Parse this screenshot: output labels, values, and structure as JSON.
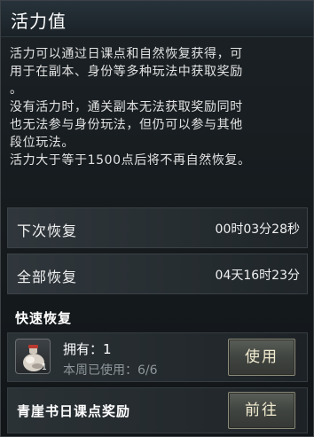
{
  "header": {
    "title": "活力值"
  },
  "description": {
    "lines": [
      "活力可以通过日课点和自然恢复获得，可",
      "用于在副本、身份等多种玩法中获取奖励",
      "。",
      "没有活力时，通关副本无法获取奖励同时",
      "也无法参与身份玩法，但仍可以参与其他",
      "段位玩法。",
      "活力大于等于1500点后将不再自然恢复。"
    ]
  },
  "recovery": {
    "next_label": "下次恢复",
    "next_value": "00时03分28秒",
    "full_label": "全部恢复",
    "full_value": "04天16时23分"
  },
  "quick_recovery": {
    "title": "快速恢复",
    "item": {
      "icon": "potion-flask-icon",
      "count": "1",
      "owned": "拥有：1",
      "weekly_used": "本周已使用：6/6"
    },
    "use_button": "使用"
  },
  "reward": {
    "label": "青崖书日课点奖励",
    "goto_button": "前往"
  },
  "colors": {
    "button_text": "#f2ecd0",
    "muted_text": "#8e969b"
  }
}
